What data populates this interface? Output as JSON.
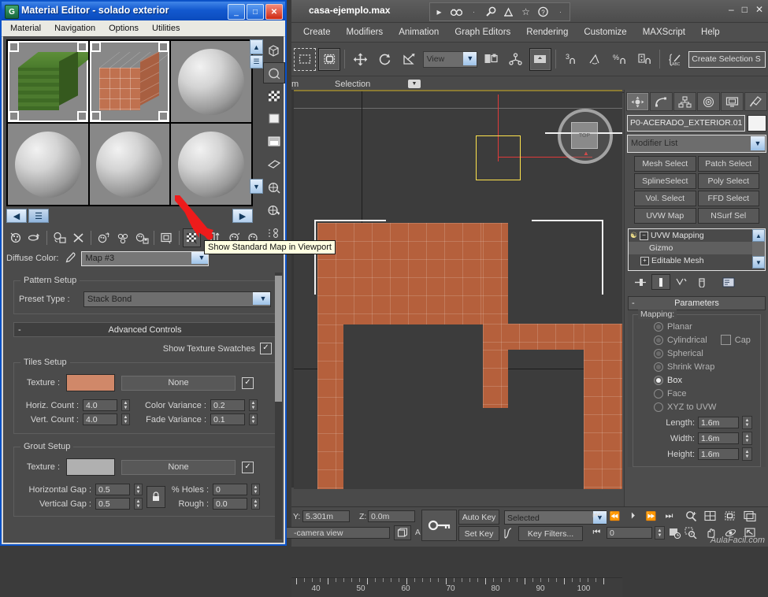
{
  "material_editor": {
    "window_title": "Material Editor - solado exterior",
    "icon": "material-editor-icon",
    "window_buttons": {
      "minimize": "_",
      "maximize": "□",
      "close": "✕"
    },
    "menu": [
      "Material",
      "Navigation",
      "Options",
      "Utilities"
    ],
    "sample_slots": [
      {
        "name": "slot-1",
        "kind": "cube",
        "color": "#4a7a2c",
        "active": false
      },
      {
        "name": "slot-2",
        "kind": "cube",
        "color": "#c06d4e",
        "active": true
      },
      {
        "name": "slot-3",
        "kind": "sphere",
        "color": "#b8b8b8",
        "active": false
      },
      {
        "name": "slot-4",
        "kind": "sphere",
        "color": "#b8b8b8",
        "active": false
      },
      {
        "name": "slot-5",
        "kind": "sphere",
        "color": "#b8b8b8",
        "active": false
      },
      {
        "name": "slot-6",
        "kind": "sphere",
        "color": "#b8b8b8",
        "active": false
      }
    ],
    "vertical_toolbar": [
      "sample-type-box-icon",
      "backlight-icon",
      "background-checker-icon",
      "sample-uv-tiling-icon",
      "video-color-check-icon",
      "make-preview-icon",
      "options-icon",
      "select-by-material-icon",
      "material-id-channel-icon"
    ],
    "horizontal_toolbar": [
      "get-material-icon",
      "put-material-to-scene-icon",
      "assign-material-to-selection-icon",
      "reset-map-icon",
      "make-material-copy-icon",
      "make-unique-icon",
      "put-to-library-icon",
      "material-effects-channel-icon",
      "show-standard-map-in-viewport-icon",
      "show-end-result-icon",
      "go-to-parent-icon",
      "go-forward-to-sibling-icon"
    ],
    "tooltip": "Show Standard Map in Viewport",
    "diffuse_label": "Diffuse Color:",
    "eyedropper_icon": "eyedropper-icon",
    "map_name": "Map #3",
    "pattern_setup": {
      "group_title": "Pattern Setup",
      "preset_label": "Preset Type :",
      "preset_value": "Stack Bond"
    },
    "advanced_controls": {
      "rollup_title": "Advanced Controls",
      "collapse_glyph": "-",
      "show_texture_swatches_label": "Show Texture Swatches",
      "show_texture_swatches_checked": true
    },
    "tiles_setup": {
      "group_title": "Tiles Setup",
      "texture_label": "Texture :",
      "texture_color": "#d08869",
      "texture_map": "None",
      "texture_enabled": true,
      "horiz_count_label": "Horiz. Count :",
      "horiz_count": "4.0",
      "vert_count_label": "Vert. Count :",
      "vert_count": "4.0",
      "color_variance_label": "Color Variance :",
      "color_variance": "0.2",
      "fade_variance_label": "Fade Variance :",
      "fade_variance": "0.1"
    },
    "grout_setup": {
      "group_title": "Grout Setup",
      "texture_label": "Texture :",
      "texture_color": "#b0b0b0",
      "texture_map": "None",
      "texture_enabled": true,
      "horizontal_gap_label": "Horizontal Gap :",
      "horizontal_gap": "0.5",
      "vertical_gap_label": "Vertical Gap :",
      "vertical_gap": "0.5",
      "lock_icon": "lock-icon",
      "holes_label": "% Holes :",
      "holes": "0",
      "rough_label": "Rough :",
      "rough": "0.0"
    }
  },
  "max": {
    "title": "casa-ejemplo.max",
    "quick_access": [
      "undo-redo-arrow-icon",
      "select-object-icon",
      "dot-icon",
      "zoom-icon",
      "render-icon",
      "favorites-star-icon",
      "help-icon",
      "dot2-icon"
    ],
    "window_buttons": {
      "minimize": "–",
      "maximize": "□",
      "close": "✕"
    },
    "menu": [
      "Create",
      "Modifiers",
      "Animation",
      "Graph Editors",
      "Rendering",
      "Customize",
      "MAXScript",
      "Help"
    ],
    "toolbar": {
      "icons": [
        "select-region-icon",
        "select-object-icon",
        "select-and-move-icon",
        "select-and-rotate-icon",
        "select-and-scale-icon",
        "reference-coord-system",
        "use-center-icon",
        "select-and-link-icon",
        "mirror-icon",
        "snap-toggle-3-icon",
        "angle-snap-icon",
        "percent-snap-icon",
        "spinner-snap-icon",
        "named-selection-sets-icon"
      ],
      "view_combo": "View",
      "snap_number": "3",
      "create_selection_set_placeholder": "Create Selection S"
    },
    "strip": {
      "left": "m",
      "label": "Selection",
      "dropdown": "▼"
    },
    "viewport": {
      "label": "TOP",
      "view_cube": "view-cube-icon",
      "ruler_ticks": [
        "40",
        "50",
        "60",
        "70",
        "80",
        "90",
        "100"
      ]
    },
    "status": {
      "y_label": "Y:",
      "y_value": "5.301m",
      "z_label": "Z:",
      "z_value": "0.0m",
      "camera_text": "-camera view",
      "key_icon": "key-icon",
      "auto_key": "Auto Key",
      "set_key": "Set Key",
      "selected_combo": "Selected",
      "key_filters": "Key Filters...",
      "frame_value": "0",
      "transport_icons": [
        "go-to-start-icon",
        "previous-frame-icon",
        "play-animation-icon",
        "next-frame-icon",
        "go-to-end-icon"
      ],
      "nav_icons_top": [
        "zoom-icon",
        "zoom-all-icon",
        "zoom-extents-icon",
        "zoom-extents-all-icon"
      ],
      "nav_icons_bottom": [
        "region-zoom-icon",
        "pan-view-icon",
        "orbit-icon",
        "maximize-viewport-toggle-icon"
      ],
      "key_mode_icon": "key-mode-toggle-icon",
      "time-config-icon": "time-configuration-icon"
    },
    "command_panel": {
      "tabs": [
        "create-tab-icon",
        "modify-tab-icon",
        "hierarchy-tab-icon",
        "motion-tab-icon",
        "display-tab-icon",
        "utilities-tab-icon"
      ],
      "selected_tab_index": 1,
      "object_name": "P0-ACERADO_EXTERIOR.01",
      "modifier_list": "Modifier List",
      "modifier_buttons": [
        "Mesh Select",
        "Patch Select",
        "SplineSelect",
        "Poly Select",
        "Vol. Select",
        "FFD Select",
        "UVW Map",
        "NSurf Sel"
      ],
      "stack": [
        {
          "label": "UVW Mapping",
          "level": 0,
          "selected": false,
          "toggle": "−",
          "bulb": "light-bulb-icon"
        },
        {
          "label": "Gizmo",
          "level": 1,
          "selected": true,
          "toggle": "",
          "bulb": ""
        },
        {
          "label": "Editable Mesh",
          "level": 0,
          "selected": false,
          "toggle": "+",
          "bulb": ""
        }
      ],
      "stack_tools": [
        "pin-stack-icon",
        "show-end-result-icon",
        "make-unique-icon",
        "remove-modifier-icon",
        "configure-modifier-sets-icon"
      ],
      "parameters": {
        "rollup_title": "Parameters",
        "collapse_glyph": "-",
        "mapping_group": "Mapping:",
        "mapping_options": [
          {
            "label": "Planar",
            "selected": false
          },
          {
            "label": "Cylindrical",
            "selected": false
          },
          {
            "label": "Spherical",
            "selected": false
          },
          {
            "label": "Shrink Wrap",
            "selected": false
          },
          {
            "label": "Box",
            "selected": true
          },
          {
            "label": "Face",
            "selected": false
          },
          {
            "label": "XYZ to UVW",
            "selected": false
          }
        ],
        "cap_label": "Cap",
        "cap_checked": false,
        "length_label": "Length:",
        "length": "1.6m",
        "width_label": "Width:",
        "width": "1.6m",
        "height_label": "Height:",
        "height": "1.6m"
      }
    }
  },
  "watermark": "AulaFacil.com"
}
